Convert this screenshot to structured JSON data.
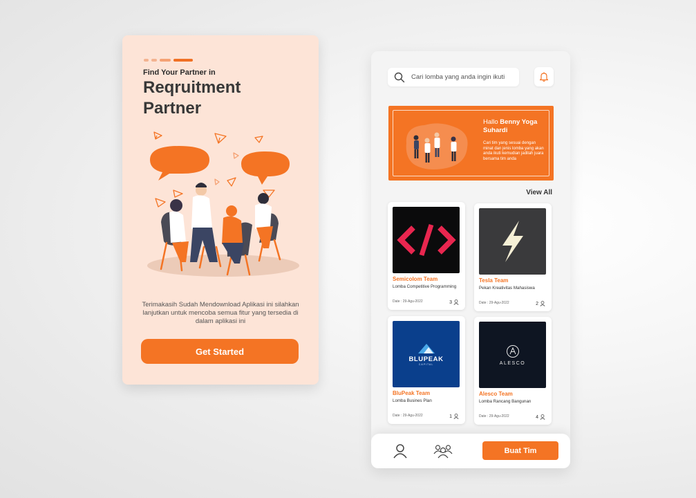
{
  "onboarding": {
    "subtitle": "Find Your Partner in",
    "title": "Reqruitment Partner",
    "description": "Terimakasih Sudah Mendownload Aplikasi ini silahkan lanjutkan untuk mencoba semua fitur yang tersedia di dalam aplikasi ini",
    "button_label": "Get Started",
    "page_indicator": {
      "count": 4,
      "active": 4
    }
  },
  "home": {
    "search": {
      "placeholder": "Cari lomba yang anda ingin ikuti"
    },
    "banner": {
      "greeting": "Hallo",
      "user_name": "Benny Yoga Suhardi",
      "text": "Cari tim yang sesuai dengan minat dan jenis lomba yang akan anda ikuti kemudian jadilah juara bersama tim anda"
    },
    "view_all_label": "View All",
    "teams": [
      {
        "name": "Semicolom Team",
        "competition": "Lomba Competitive Programming",
        "date": "Date : 29-Agu-2022",
        "members": "3",
        "logo_icon": "code-icon"
      },
      {
        "name": "Tesla Team",
        "competition": "Pekan Kreativitas Mahasiswa",
        "date": "Date : 29-Agu-2022",
        "members": "2",
        "logo_icon": "lightning-icon"
      },
      {
        "name": "BluPeak Team",
        "competition": "Lomba Busines Plan",
        "date": "Date : 29-Agu-2022",
        "members": "1",
        "logo_icon": "blupeak-logo",
        "logo_text": "BLUPEAK",
        "logo_subtext": "CAPITAL"
      },
      {
        "name": "Alesco Team",
        "competition": "Lomba Rancang Bangunan",
        "date": "Date : 29-Agu-2022",
        "members": "4",
        "logo_icon": "alesco-logo",
        "logo_text": "ALESCO"
      }
    ],
    "bottom_nav": {
      "create_team_label": "Buat Tim"
    }
  },
  "colors": {
    "accent": "#f47424",
    "onboarding_bg": "#fde4d7",
    "home_bg": "#f4f4f4"
  }
}
